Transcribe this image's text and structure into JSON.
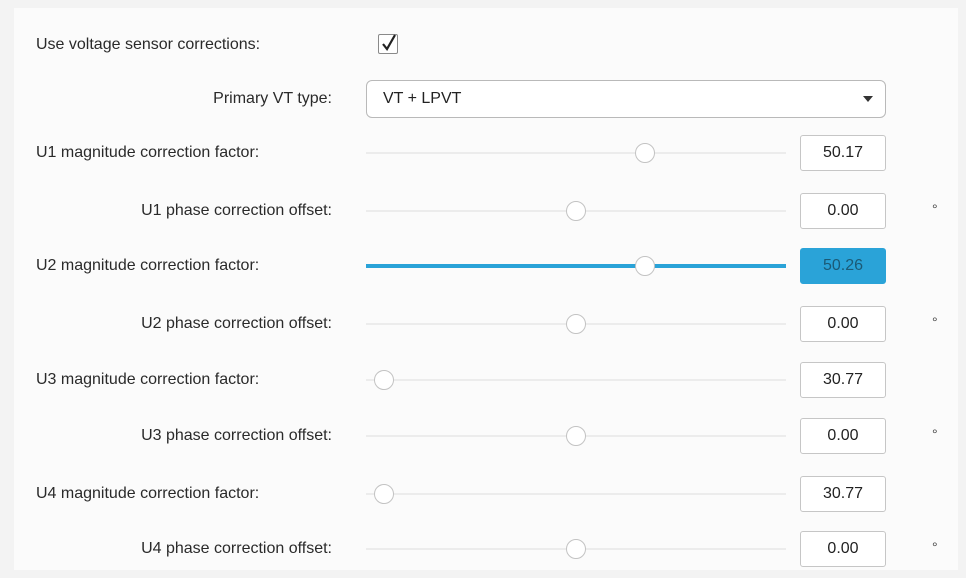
{
  "voltage_sensor_corrections": {
    "label": "Use voltage sensor corrections:",
    "checked": true
  },
  "primary_vt_type": {
    "label": "Primary VT type:",
    "value": "VT + LPVT"
  },
  "rows": [
    {
      "id": "u1-magnitude",
      "label": "U1 magnitude correction factor:",
      "value": "50.17",
      "slider_fraction": 0.68,
      "unit": ""
    },
    {
      "id": "u1-phase",
      "label": "U1 phase correction offset:",
      "value": "0.00",
      "slider_fraction": 0.5,
      "unit": "°"
    },
    {
      "id": "u2-magnitude",
      "label": "U2 magnitude correction factor:",
      "value": "50.26",
      "slider_fraction": 0.68,
      "unit": ""
    },
    {
      "id": "u2-phase",
      "label": "U2 phase correction offset:",
      "value": "0.00",
      "slider_fraction": 0.5,
      "unit": "°"
    },
    {
      "id": "u3-magnitude",
      "label": "U3 magnitude correction factor:",
      "value": "30.77",
      "slider_fraction": 0.0,
      "unit": ""
    },
    {
      "id": "u3-phase",
      "label": "U3 phase correction offset:",
      "value": "0.00",
      "slider_fraction": 0.5,
      "unit": "°"
    },
    {
      "id": "u4-magnitude",
      "label": "U4 magnitude correction factor:",
      "value": "30.77",
      "slider_fraction": 0.0,
      "unit": ""
    },
    {
      "id": "u4-phase",
      "label": "U4 phase correction offset:",
      "value": "0.00",
      "slider_fraction": 0.5,
      "unit": "°"
    }
  ],
  "colors": {
    "accent": "#2aa3d8"
  }
}
